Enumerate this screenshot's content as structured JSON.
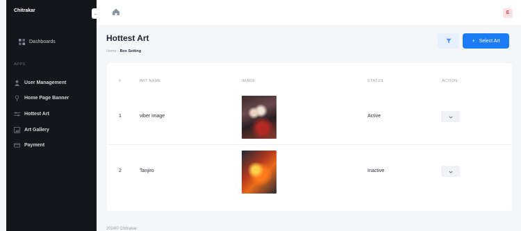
{
  "sidebar": {
    "brand": "Chitrakar",
    "collapse_glyph": "←",
    "dashboard_label": "Dashboards",
    "section_label": "APPS",
    "items": [
      {
        "label": "User Management",
        "icon": "user-icon"
      },
      {
        "label": "Home Page Banner",
        "icon": "pin-icon"
      },
      {
        "label": "Hottest Art",
        "icon": "sliders-icon"
      },
      {
        "label": "Art Gallery",
        "icon": "gallery-icon"
      },
      {
        "label": "Payment",
        "icon": "card-icon"
      }
    ]
  },
  "topbar": {
    "avatar_letter": "E",
    "home_icon": "home-icon"
  },
  "page": {
    "title": "Hottest Art",
    "breadcrumb_home": "Home",
    "breadcrumb_sep": "-",
    "breadcrumb_current": "Box Setting",
    "select_button": "Select Art",
    "select_button_glyph": "+"
  },
  "table": {
    "headers": [
      "#",
      "ART NAME",
      "IMAGE",
      "STATUS",
      "ACTION"
    ],
    "rows": [
      {
        "index": "1",
        "name": "viber image",
        "status": "Active"
      },
      {
        "index": "2",
        "name": "Tanjiro",
        "status": "Inactive"
      }
    ]
  },
  "footer": {
    "text": "2024© Chitrakar"
  },
  "colors": {
    "accent": "#1b7cf5",
    "sidebar_bg": "#15161b",
    "avatar_bg": "#fde2e6",
    "avatar_fg": "#e5484d"
  }
}
